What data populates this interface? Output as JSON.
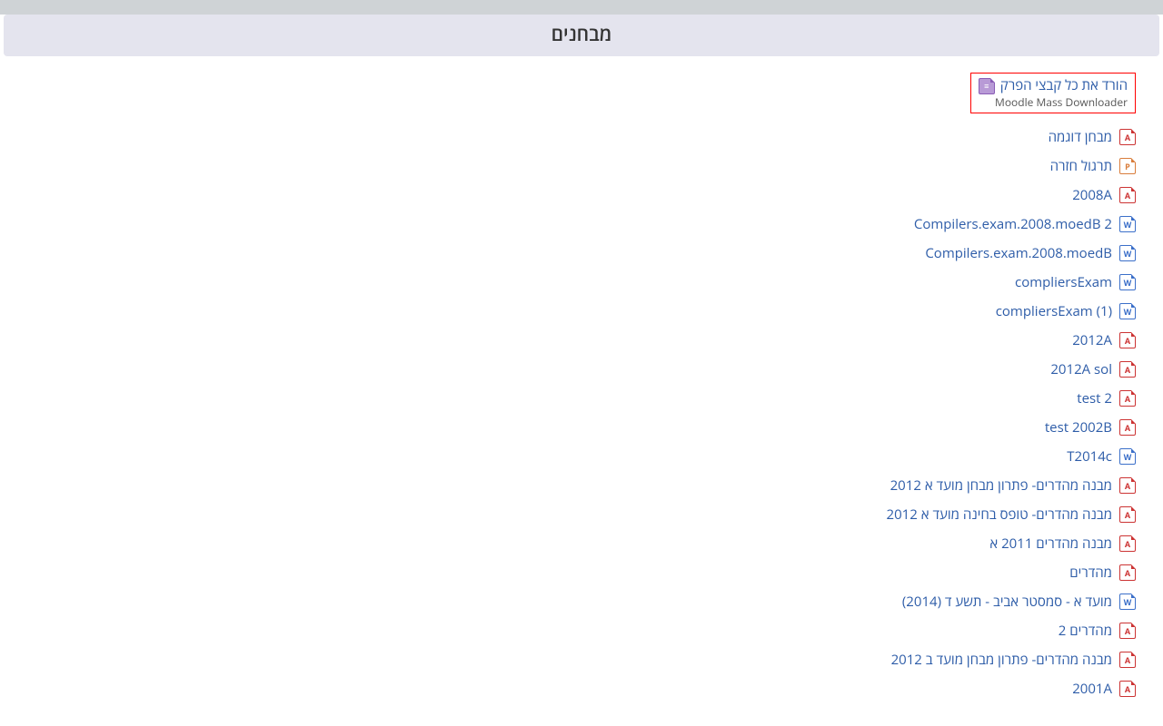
{
  "section_title": "מבחנים",
  "download_all": {
    "label": "הורד את כל קבצי הפרק",
    "subtitle": "Moodle Mass Downloader",
    "icon": "dl"
  },
  "icon_glyphs": {
    "pdf": "A",
    "doc": "W",
    "ppt": "P",
    "dl": "≡"
  },
  "resources": [
    {
      "label": "מבחן דוגמה",
      "icon": "pdf"
    },
    {
      "label": "תרגול חזרה",
      "icon": "ppt"
    },
    {
      "label": "2008A",
      "icon": "pdf"
    },
    {
      "label": "Compilers.exam.2008.moedB 2",
      "icon": "doc"
    },
    {
      "label": "Compilers.exam.2008.moedB",
      "icon": "doc"
    },
    {
      "label": "compliersExam",
      "icon": "doc"
    },
    {
      "label": "compliersExam (1)",
      "icon": "doc"
    },
    {
      "label": "2012A",
      "icon": "pdf"
    },
    {
      "label": "2012A sol",
      "icon": "pdf"
    },
    {
      "label": "test 2",
      "icon": "pdf"
    },
    {
      "label": "test 2002B",
      "icon": "pdf"
    },
    {
      "label": "T2014c",
      "icon": "doc"
    },
    {
      "label": "מבנה מהדרים- פתרון מבחן מועד א 2012",
      "icon": "pdf"
    },
    {
      "label": "מבנה מהדרים- טופס בחינה מועד א 2012",
      "icon": "pdf"
    },
    {
      "label": "מבנה מהדרים 2011 א",
      "icon": "pdf"
    },
    {
      "label": "מהדרים",
      "icon": "pdf"
    },
    {
      "label": "מועד א - סמסטר אביב - תשע ד (2014)",
      "icon": "doc"
    },
    {
      "label": "מהדרים 2",
      "icon": "pdf"
    },
    {
      "label": "מבנה מהדרים- פתרון מבחן מועד ב 2012",
      "icon": "pdf"
    },
    {
      "label": "2001A",
      "icon": "pdf"
    }
  ]
}
